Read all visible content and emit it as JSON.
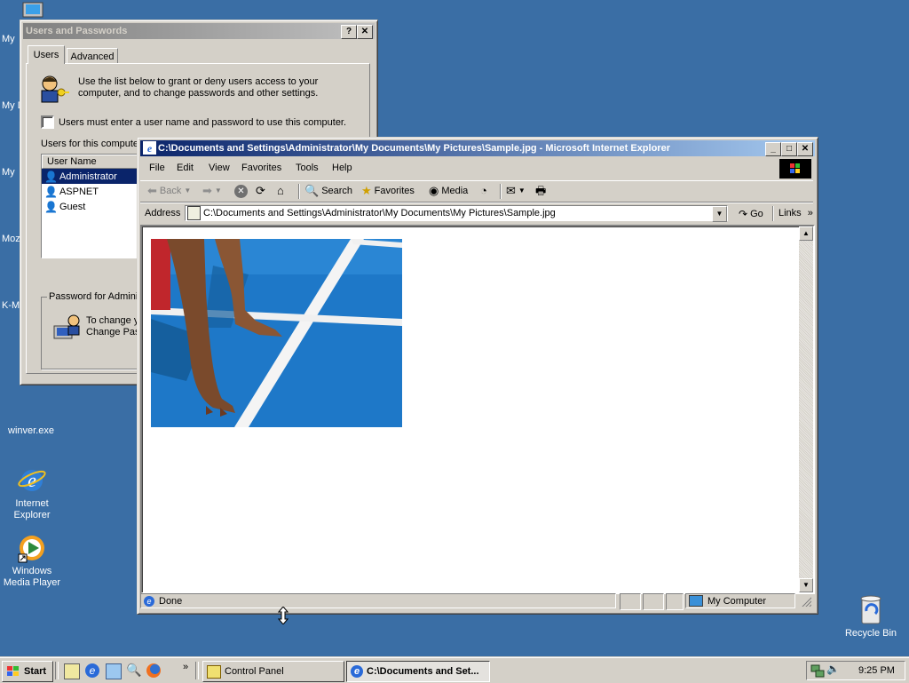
{
  "desktop": {
    "icons": [
      {
        "label": "winver.exe"
      },
      {
        "label": "Internet Explorer"
      },
      {
        "label": "Windows Media Player"
      },
      {
        "label": "Recycle Bin"
      }
    ],
    "cut_labels": [
      "My",
      "My D",
      "My",
      "Moz",
      "K-M"
    ]
  },
  "users_dialog": {
    "title": "Users and Passwords",
    "tabs": [
      "Users",
      "Advanced"
    ],
    "intro_line1": "Use the list below to grant or deny users access to your",
    "intro_line2": "computer, and to change passwords and other settings.",
    "checkbox_label": "Users must enter a user name and password to use this computer.",
    "users_for_label": "Users for this compute",
    "column_header": "User Name",
    "users": [
      "Administrator",
      "ASPNET",
      "Guest"
    ],
    "password_group": "Password for Adminis",
    "password_line1": "To change y",
    "password_line2": "Change Pas"
  },
  "ie_window": {
    "title": "C:\\Documents and Settings\\Administrator\\My Documents\\My Pictures\\Sample.jpg - Microsoft Internet Explorer",
    "menu": [
      "File",
      "Edit",
      "View",
      "Favorites",
      "Tools",
      "Help"
    ],
    "toolbar": {
      "back": "Back",
      "search": "Search",
      "favorites": "Favorites",
      "media": "Media"
    },
    "address_label": "Address",
    "address_value": "C:\\Documents and Settings\\Administrator\\My Documents\\My Pictures\\Sample.jpg",
    "go_label": "Go",
    "links_label": "Links",
    "status_text": "Done",
    "zone_text": "My Computer"
  },
  "taskbar": {
    "start_label": "Start",
    "tasks": [
      "Control Panel",
      "C:\\Documents and Set..."
    ],
    "clock": "9:25 PM"
  }
}
